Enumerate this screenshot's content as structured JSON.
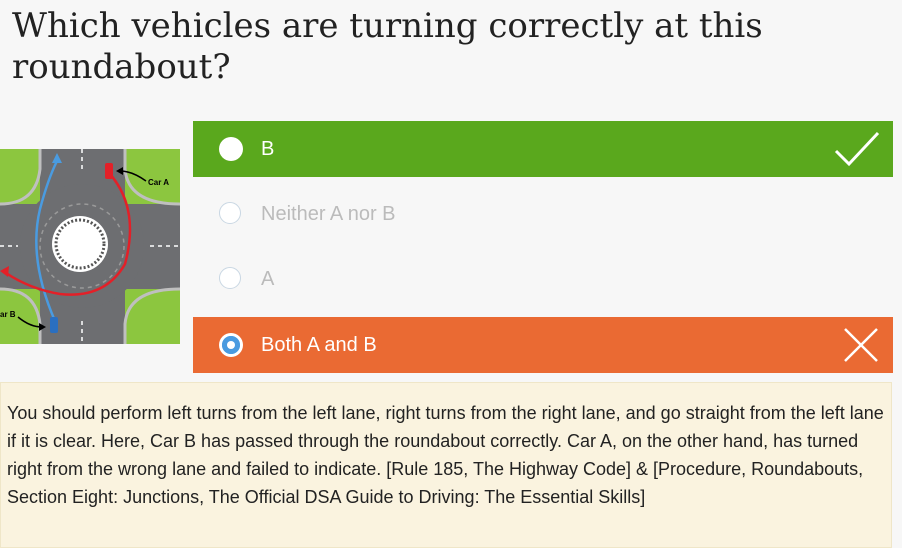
{
  "question": "Which vehicles are turning correctly at this roundabout?",
  "diagram": {
    "car_a_label": "Car A",
    "car_b_label": "ar B"
  },
  "answers": [
    {
      "label": "B",
      "state": "correct"
    },
    {
      "label": "Neither A nor B",
      "state": "neutral"
    },
    {
      "label": "A",
      "state": "neutral"
    },
    {
      "label": "Both A and B",
      "state": "selected-wrong"
    }
  ],
  "icons": {
    "correct": "checkmark-icon",
    "wrong": "cross-icon"
  },
  "colors": {
    "correct": "#5aa81d",
    "wrong": "#ea6a33",
    "explanation_bg": "#faf3df"
  },
  "explanation": "You should perform left turns from the left lane, right turns from the right lane, and go straight from the left lane if it is clear. Here, Car B has passed through the roundabout correctly. Car A, on the other hand, has turned right from the wrong lane and failed to indicate. [Rule 185, The Highway Code] & [Procedure, Roundabouts, Section Eight: Junctions, The Official DSA Guide to Driving: The Essential Skills]"
}
